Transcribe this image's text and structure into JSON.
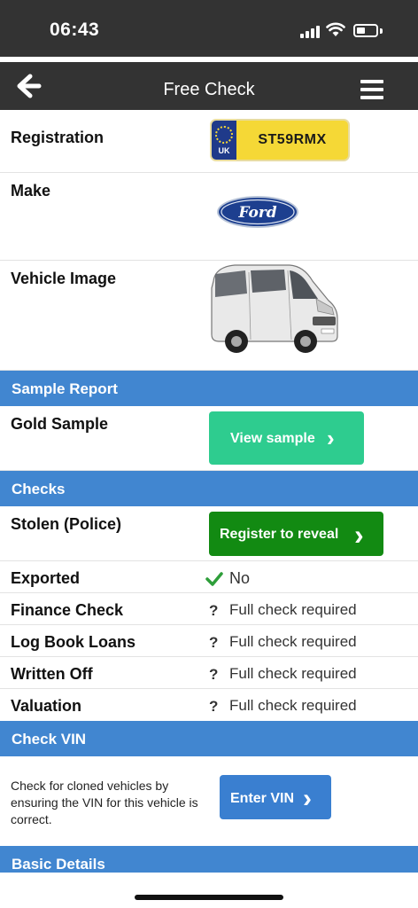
{
  "status_bar": {
    "time": "06:43",
    "battery_level": 0.3
  },
  "nav": {
    "title": "Free Check",
    "back_icon": "arrow-left-icon",
    "menu_icon": "hamburger-menu-icon"
  },
  "registration": {
    "label": "Registration",
    "plate_country": "UK",
    "plate_number": "ST59RMX"
  },
  "make": {
    "label": "Make",
    "logo_text": "Ford"
  },
  "vehicle_image": {
    "label": "Vehicle Image"
  },
  "sample_report": {
    "header": "Sample Report",
    "gold_label": "Gold Sample",
    "view_button": "View sample",
    "button_color": "#2ecc8f"
  },
  "checks": {
    "header": "Checks",
    "stolen": {
      "label": "Stolen (Police)",
      "button": "Register to reveal",
      "button_color": "#128a12"
    },
    "items": [
      {
        "label": "Exported",
        "value": "No",
        "icon": "check-icon"
      },
      {
        "label": "Finance Check",
        "value": "Full check required",
        "icon": "question-icon"
      },
      {
        "label": "Log Book Loans",
        "value": "Full check required",
        "icon": "question-icon"
      },
      {
        "label": "Written Off",
        "value": "Full check required",
        "icon": "question-icon"
      },
      {
        "label": "Valuation",
        "value": "Full check required",
        "icon": "question-icon"
      }
    ]
  },
  "check_vin": {
    "header": "Check VIN",
    "description": "Check for cloned vehicles by ensuring the VIN for this vehicle is correct.",
    "button": "Enter VIN",
    "button_color": "#3a7fd0"
  },
  "basic_details": {
    "header": "Basic Details"
  },
  "colors": {
    "section_header": "#4186d0",
    "nav_bar": "#333333",
    "check_green": "#2e9e3a"
  }
}
